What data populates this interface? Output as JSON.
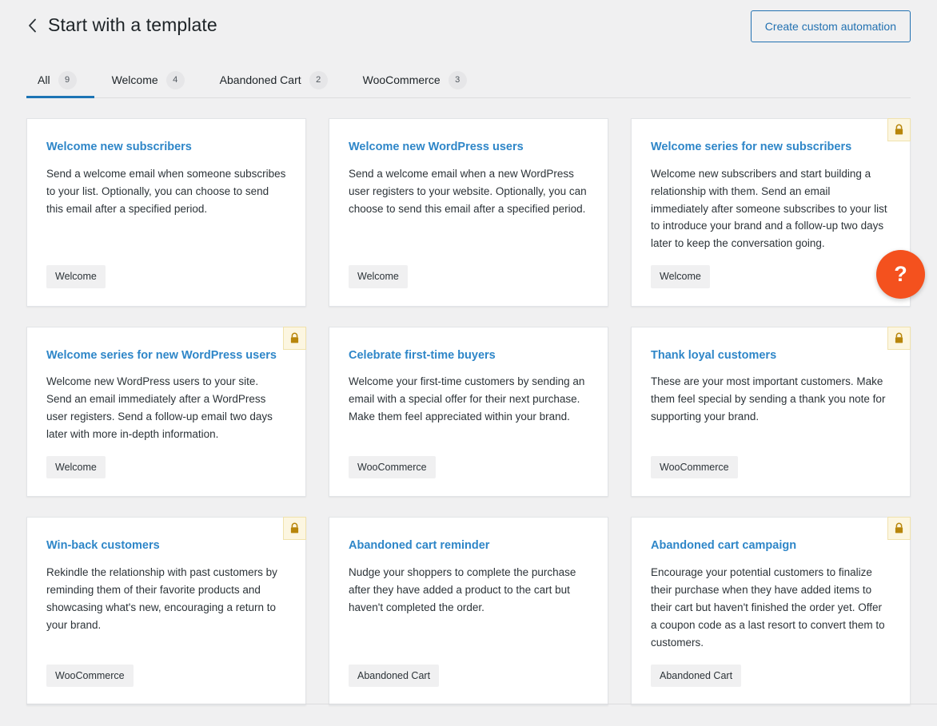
{
  "header": {
    "back_icon": "chevron-left-icon",
    "title": "Start with a template",
    "action_button": "Create custom automation"
  },
  "tabs": [
    {
      "label": "All",
      "count": "9",
      "active": true
    },
    {
      "label": "Welcome",
      "count": "4",
      "active": false
    },
    {
      "label": "Abandoned Cart",
      "count": "2",
      "active": false
    },
    {
      "label": "WooCommerce",
      "count": "3",
      "active": false
    }
  ],
  "cards": [
    {
      "title": "Welcome new subscribers",
      "description": "Send a welcome email when someone subscribes to your list. Optionally, you can choose to send this email after a specified period.",
      "tag": "Welcome",
      "locked": false
    },
    {
      "title": "Welcome new WordPress users",
      "description": "Send a welcome email when a new WordPress user registers to your website. Optionally, you can choose to send this email after a specified period.",
      "tag": "Welcome",
      "locked": false
    },
    {
      "title": "Welcome series for new subscribers",
      "description": "Welcome new subscribers and start building a relationship with them. Send an email immediately after someone subscribes to your list to introduce your brand and a follow-up two days later to keep the conversation going.",
      "tag": "Welcome",
      "locked": true
    },
    {
      "title": "Welcome series for new WordPress users",
      "description": "Welcome new WordPress users to your site. Send an email immediately after a WordPress user registers. Send a follow-up email two days later with more in-depth information.",
      "tag": "Welcome",
      "locked": true
    },
    {
      "title": "Celebrate first-time buyers",
      "description": "Welcome your first-time customers by sending an email with a special offer for their next purchase. Make them feel appreciated within your brand.",
      "tag": "WooCommerce",
      "locked": false
    },
    {
      "title": "Thank loyal customers",
      "description": "These are your most important customers. Make them feel special by sending a thank you note for supporting your brand.",
      "tag": "WooCommerce",
      "locked": true
    },
    {
      "title": "Win-back customers",
      "description": "Rekindle the relationship with past customers by reminding them of their favorite products and showcasing what's new, encouraging a return to your brand.",
      "tag": "WooCommerce",
      "locked": true
    },
    {
      "title": "Abandoned cart reminder",
      "description": "Nudge your shoppers to complete the purchase after they have added a product to the cart but haven't completed the order.",
      "tag": "Abandoned Cart",
      "locked": false
    },
    {
      "title": "Abandoned cart campaign",
      "description": "Encourage your potential customers to finalize their purchase when they have added items to their cart but haven't finished the order yet. Offer a coupon code as a last resort to convert them to customers.",
      "tag": "Abandoned Cart",
      "locked": true
    }
  ],
  "help": {
    "icon": "question-mark-icon",
    "label": "?"
  },
  "colors": {
    "accent_blue": "#2271b1",
    "tab_active_underline": "#1d74b5",
    "card_title_blue": "#2e86c8",
    "lock_badge_bg": "#fcf6e1",
    "lock_badge_border": "#f0e2ad",
    "lock_glyph": "#b8860b",
    "help_orange": "#f4511e",
    "page_bg": "#f0f0f1"
  }
}
